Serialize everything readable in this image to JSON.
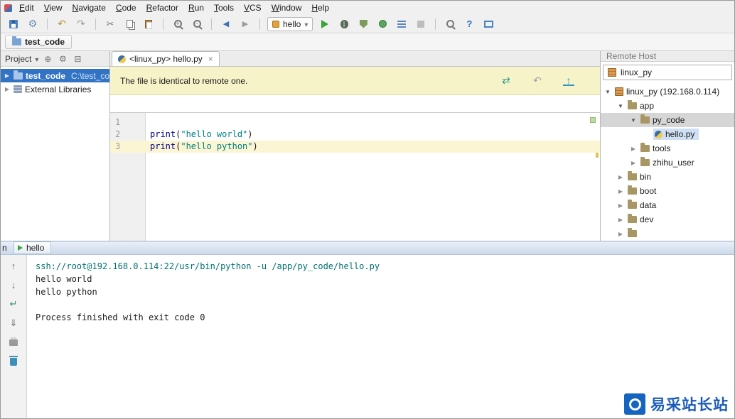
{
  "menubar": {
    "items": [
      "Edit",
      "View",
      "Navigate",
      "Code",
      "Refactor",
      "Run",
      "Tools",
      "VCS",
      "Window",
      "Help"
    ]
  },
  "toolbar": {
    "run_config_label": "hello"
  },
  "navbar": {
    "crumb": "test_code"
  },
  "project": {
    "header": "Project",
    "root": {
      "name": "test_code",
      "path": "C:\\test_cod"
    },
    "external_libraries": "External Libraries"
  },
  "editor": {
    "tab_title": "<linux_py> hello.py",
    "banner_text": "The file is identical to remote one.",
    "lines": [
      {
        "num": "1"
      },
      {
        "num": "2",
        "fn": "print",
        "open": "(",
        "str": "\"hello world\"",
        "close": ")"
      },
      {
        "num": "3",
        "fn": "print",
        "open": "(",
        "str": "\"hello python\"",
        "close": ")"
      }
    ]
  },
  "remote": {
    "header": "Remote Host",
    "server_select": "linux_py",
    "tree": [
      {
        "label": "linux_py (192.168.0.114)"
      },
      {
        "label": "app"
      },
      {
        "label": "py_code"
      },
      {
        "label": "hello.py"
      },
      {
        "label": "tools"
      },
      {
        "label": "zhihu_user"
      },
      {
        "label": "bin"
      },
      {
        "label": "boot"
      },
      {
        "label": "data"
      },
      {
        "label": "dev"
      }
    ]
  },
  "run_panel": {
    "partial_label": "n",
    "tab": "hello",
    "console": [
      "ssh://root@192.168.0.114:22/usr/bin/python -u /app/py_code/hello.py",
      "hello world",
      "hello python",
      "",
      "Process finished with exit code 0"
    ]
  },
  "watermark": {
    "text": "易采站长站"
  },
  "colors": {
    "selection_blue": "#3273c4",
    "banner_yellow": "#f7f3c8",
    "current_line_yellow": "#fcf5d4",
    "string_green": "#008080",
    "builtin_blue": "#000080",
    "run_green": "#3aa33a",
    "watermark_blue": "#1565c0"
  }
}
